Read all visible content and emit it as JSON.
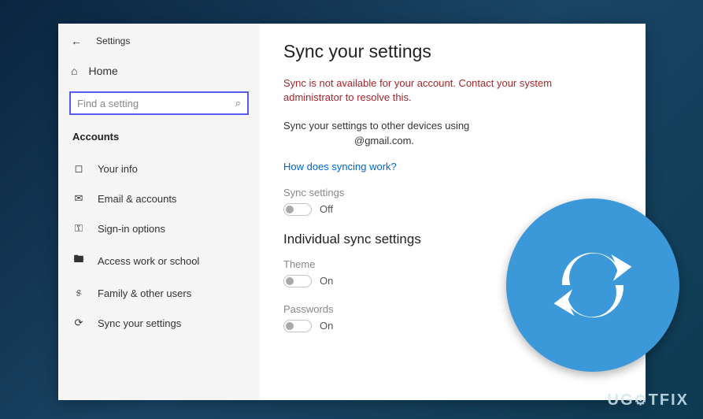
{
  "header": {
    "title": "Settings"
  },
  "home": {
    "label": "Home"
  },
  "search": {
    "placeholder": "Find a setting"
  },
  "section": {
    "label": "Accounts"
  },
  "nav": {
    "items": [
      {
        "label": "Your info"
      },
      {
        "label": "Email & accounts"
      },
      {
        "label": "Sign-in options"
      },
      {
        "label": "Access work or school"
      },
      {
        "label": "Family & other users"
      },
      {
        "label": "Sync your settings"
      }
    ]
  },
  "main": {
    "title": "Sync your settings",
    "error": "Sync is not available for your account. Contact your system administrator to resolve this.",
    "desc_line1": "Sync your settings to other devices using",
    "desc_line2": "@gmail.com.",
    "link": "How does syncing work?",
    "sync_label": "Sync settings",
    "sync_state": "Off",
    "section_heading": "Individual sync settings",
    "theme_label": "Theme",
    "theme_state": "On",
    "passwords_label": "Passwords",
    "passwords_state": "On"
  },
  "watermark": {
    "text_pre": "UG",
    "text_post": "TFIX"
  }
}
